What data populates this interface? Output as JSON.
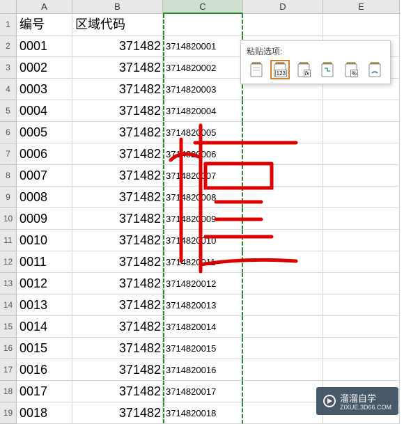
{
  "columns": [
    "",
    "A",
    "B",
    "C",
    "D",
    "E"
  ],
  "header_row": {
    "a": "编号",
    "b": "区域代码"
  },
  "rows": [
    {
      "n": "1"
    },
    {
      "n": "2",
      "a": "0001",
      "b": "371482",
      "c": "3714820001"
    },
    {
      "n": "3",
      "a": "0002",
      "b": "371482",
      "c": "3714820002"
    },
    {
      "n": "4",
      "a": "0003",
      "b": "371482",
      "c": "3714820003"
    },
    {
      "n": "5",
      "a": "0004",
      "b": "371482",
      "c": "3714820004"
    },
    {
      "n": "6",
      "a": "0005",
      "b": "371482",
      "c": "3714820005"
    },
    {
      "n": "7",
      "a": "0006",
      "b": "371482",
      "c": "3714820006"
    },
    {
      "n": "8",
      "a": "0007",
      "b": "371482",
      "c": "3714820007"
    },
    {
      "n": "9",
      "a": "0008",
      "b": "371482",
      "c": "3714820008"
    },
    {
      "n": "10",
      "a": "0009",
      "b": "371482",
      "c": "3714820009"
    },
    {
      "n": "11",
      "a": "0010",
      "b": "371482",
      "c": "3714820010"
    },
    {
      "n": "12",
      "a": "0011",
      "b": "371482",
      "c": "3714820011"
    },
    {
      "n": "13",
      "a": "0012",
      "b": "371482",
      "c": "3714820012"
    },
    {
      "n": "14",
      "a": "0013",
      "b": "371482",
      "c": "3714820013"
    },
    {
      "n": "15",
      "a": "0014",
      "b": "371482",
      "c": "3714820014"
    },
    {
      "n": "16",
      "a": "0015",
      "b": "371482",
      "c": "3714820015"
    },
    {
      "n": "17",
      "a": "0016",
      "b": "371482",
      "c": "3714820016"
    },
    {
      "n": "18",
      "a": "0017",
      "b": "371482",
      "c": "3714820017"
    },
    {
      "n": "19",
      "a": "0018",
      "b": "371482",
      "c": "3714820018"
    }
  ],
  "paste_options": {
    "title": "粘贴选项:",
    "value_badge": "123",
    "fx_label": "fx",
    "percent_label": "%"
  },
  "handwriting_char": "值",
  "watermark": {
    "brand": "溜溜自学",
    "url": "ZIXUE.3D66.COM"
  }
}
